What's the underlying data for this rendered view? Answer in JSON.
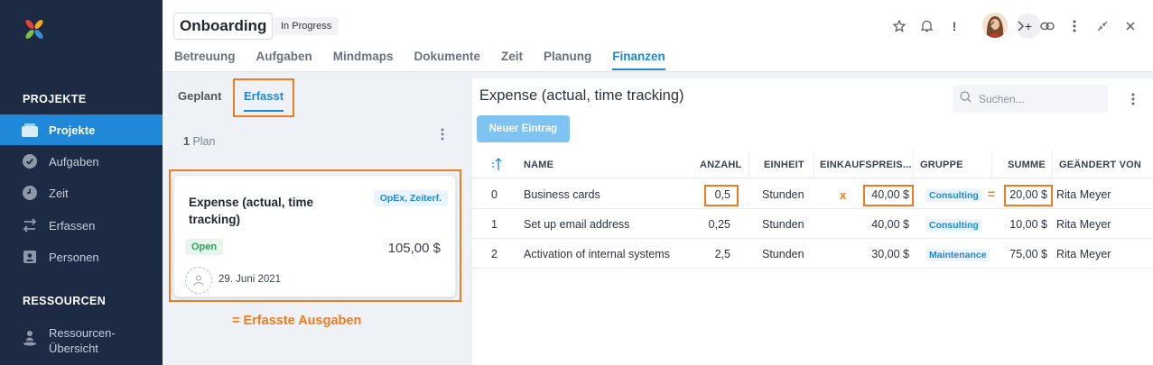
{
  "sidebar": {
    "section1": "PROJEKTE",
    "items": [
      {
        "label": "Projekte",
        "icon": "folder-icon",
        "active": true
      },
      {
        "label": "Aufgaben",
        "icon": "check-circle-icon"
      },
      {
        "label": "Zeit",
        "icon": "clock-icon"
      },
      {
        "label": "Erfassen",
        "icon": "transfer-icon"
      },
      {
        "label": "Personen",
        "icon": "contact-icon"
      }
    ],
    "section2": "RESSOURCEN",
    "resources": [
      {
        "label": "Ressourcen-Übersicht",
        "line1": "Ressourcen-",
        "line2": "Übersicht",
        "icon": "person-pin-icon"
      }
    ]
  },
  "header": {
    "title": "Onboarding",
    "status": "In Progress",
    "tabs": [
      "Betreuung",
      "Aufgaben",
      "Mindmaps",
      "Dokumente",
      "Zeit",
      "Planung",
      "Finanzen"
    ],
    "active_tab": "Finanzen",
    "plus_label": "+",
    "alert_label": "!"
  },
  "left": {
    "subtabs": [
      "Geplant",
      "Erfasst"
    ],
    "active_subtab": "Erfasst",
    "plan_count": "1",
    "plan_label": "Plan",
    "card": {
      "title": "Expense (actual, time tracking)",
      "tag": "OpEx, Zeiterf.",
      "status": "Open",
      "amount": "105,00 $",
      "date": "29. Juni 2021"
    },
    "annotation": "= Erfasste Ausgaben"
  },
  "right": {
    "title": "Expense (actual, time tracking)",
    "search_placeholder": "Suchen...",
    "new_button": "Neuer Eintrag",
    "columns": [
      "NAME",
      "ANZAHL",
      "EINHEIT",
      "EINKAUFSPREIS...",
      "GRUPPE",
      "SUMME",
      "GEÄNDERT VON"
    ],
    "rows": [
      {
        "idx": "0",
        "name": "Business cards",
        "qty": "0,5",
        "unit": "Stunden",
        "price": "40,00 $",
        "group": "Consulting",
        "sum": "20,00 $",
        "by": "Rita Meyer"
      },
      {
        "idx": "1",
        "name": "Set up email address",
        "qty": "0,25",
        "unit": "Stunden",
        "price": "40,00 $",
        "group": "Consulting",
        "sum": "10,00 $",
        "by": "Rita Meyer"
      },
      {
        "idx": "2",
        "name": "Activation of internal systems",
        "qty": "2,5",
        "unit": "Stunden",
        "price": "30,00 $",
        "group": "Maintenance",
        "sum": "75,00 $",
        "by": "Rita Meyer"
      }
    ],
    "op_x": "x",
    "op_eq": "="
  },
  "colors": {
    "accent": "#1f88d9",
    "annotation": "#f07c1f",
    "sidebar": "#1c2b43"
  }
}
